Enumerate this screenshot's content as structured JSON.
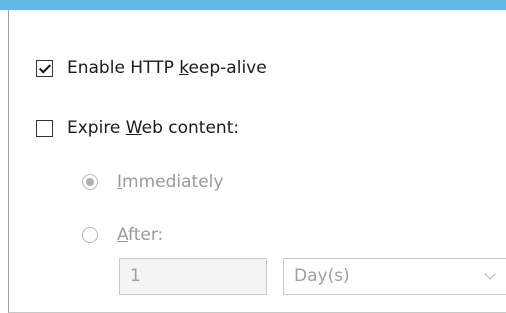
{
  "options": {
    "keep_alive": {
      "label_pre": "Enable HTTP ",
      "label_ul": "k",
      "label_post": "eep-alive",
      "checked": true
    },
    "expire": {
      "label_pre": "Expire ",
      "label_ul": "W",
      "label_post": "eb content:",
      "checked": false
    },
    "immediately": {
      "label_pre": "",
      "label_ul": "I",
      "label_post": "mmediately",
      "selected": true
    },
    "after": {
      "label_pre": "",
      "label_ul": "A",
      "label_post": "fter:",
      "selected": false
    },
    "after_value": "1",
    "after_unit": "Day(s)"
  },
  "colors": {
    "accent": "#62b9e6",
    "disabled_text": "#9a9a9a"
  }
}
